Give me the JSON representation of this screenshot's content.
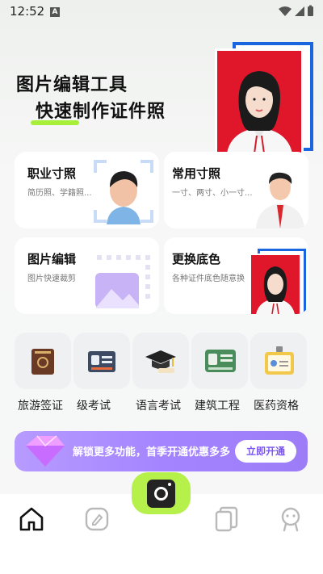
{
  "status_bar": {
    "time": "12:52",
    "notification_letter": "A"
  },
  "hero": {
    "title_line1": "图片编辑工具",
    "title_line2": "快速制作证件照"
  },
  "cards": [
    {
      "title": "职业寸照",
      "subtitle": "简历照、学籍照..."
    },
    {
      "title": "常用寸照",
      "subtitle": "一寸、两寸、小一寸..."
    },
    {
      "title": "图片编辑",
      "subtitle": "图片快速裁剪"
    },
    {
      "title": "更换底色",
      "subtitle": "各种证件底色随意换"
    }
  ],
  "categories": [
    {
      "label": "旅游签证",
      "icon": "passport-icon"
    },
    {
      "label": "级考试",
      "icon": "id-card-icon"
    },
    {
      "label": "语言考试",
      "icon": "graduation-cap-icon"
    },
    {
      "label": "建筑工程",
      "icon": "license-card-icon"
    },
    {
      "label": "医药资格",
      "icon": "badge-icon"
    }
  ],
  "banner": {
    "text": "解锁更多功能，首季开通优惠多多",
    "button": "立即开通"
  },
  "nav": {
    "items": [
      {
        "name": "home",
        "icon": "home-icon",
        "active": true
      },
      {
        "name": "edit",
        "icon": "edit-icon",
        "active": false
      },
      {
        "name": "camera",
        "icon": "camera-icon",
        "active": false
      },
      {
        "name": "photos",
        "icon": "photos-icon",
        "active": false
      },
      {
        "name": "profile",
        "icon": "profile-icon",
        "active": false
      }
    ]
  },
  "colors": {
    "accent_green": "#b6f04a",
    "banner_purple": "#a585ff",
    "photo_red": "#e0162b",
    "photo_blue": "#1a66e0"
  }
}
